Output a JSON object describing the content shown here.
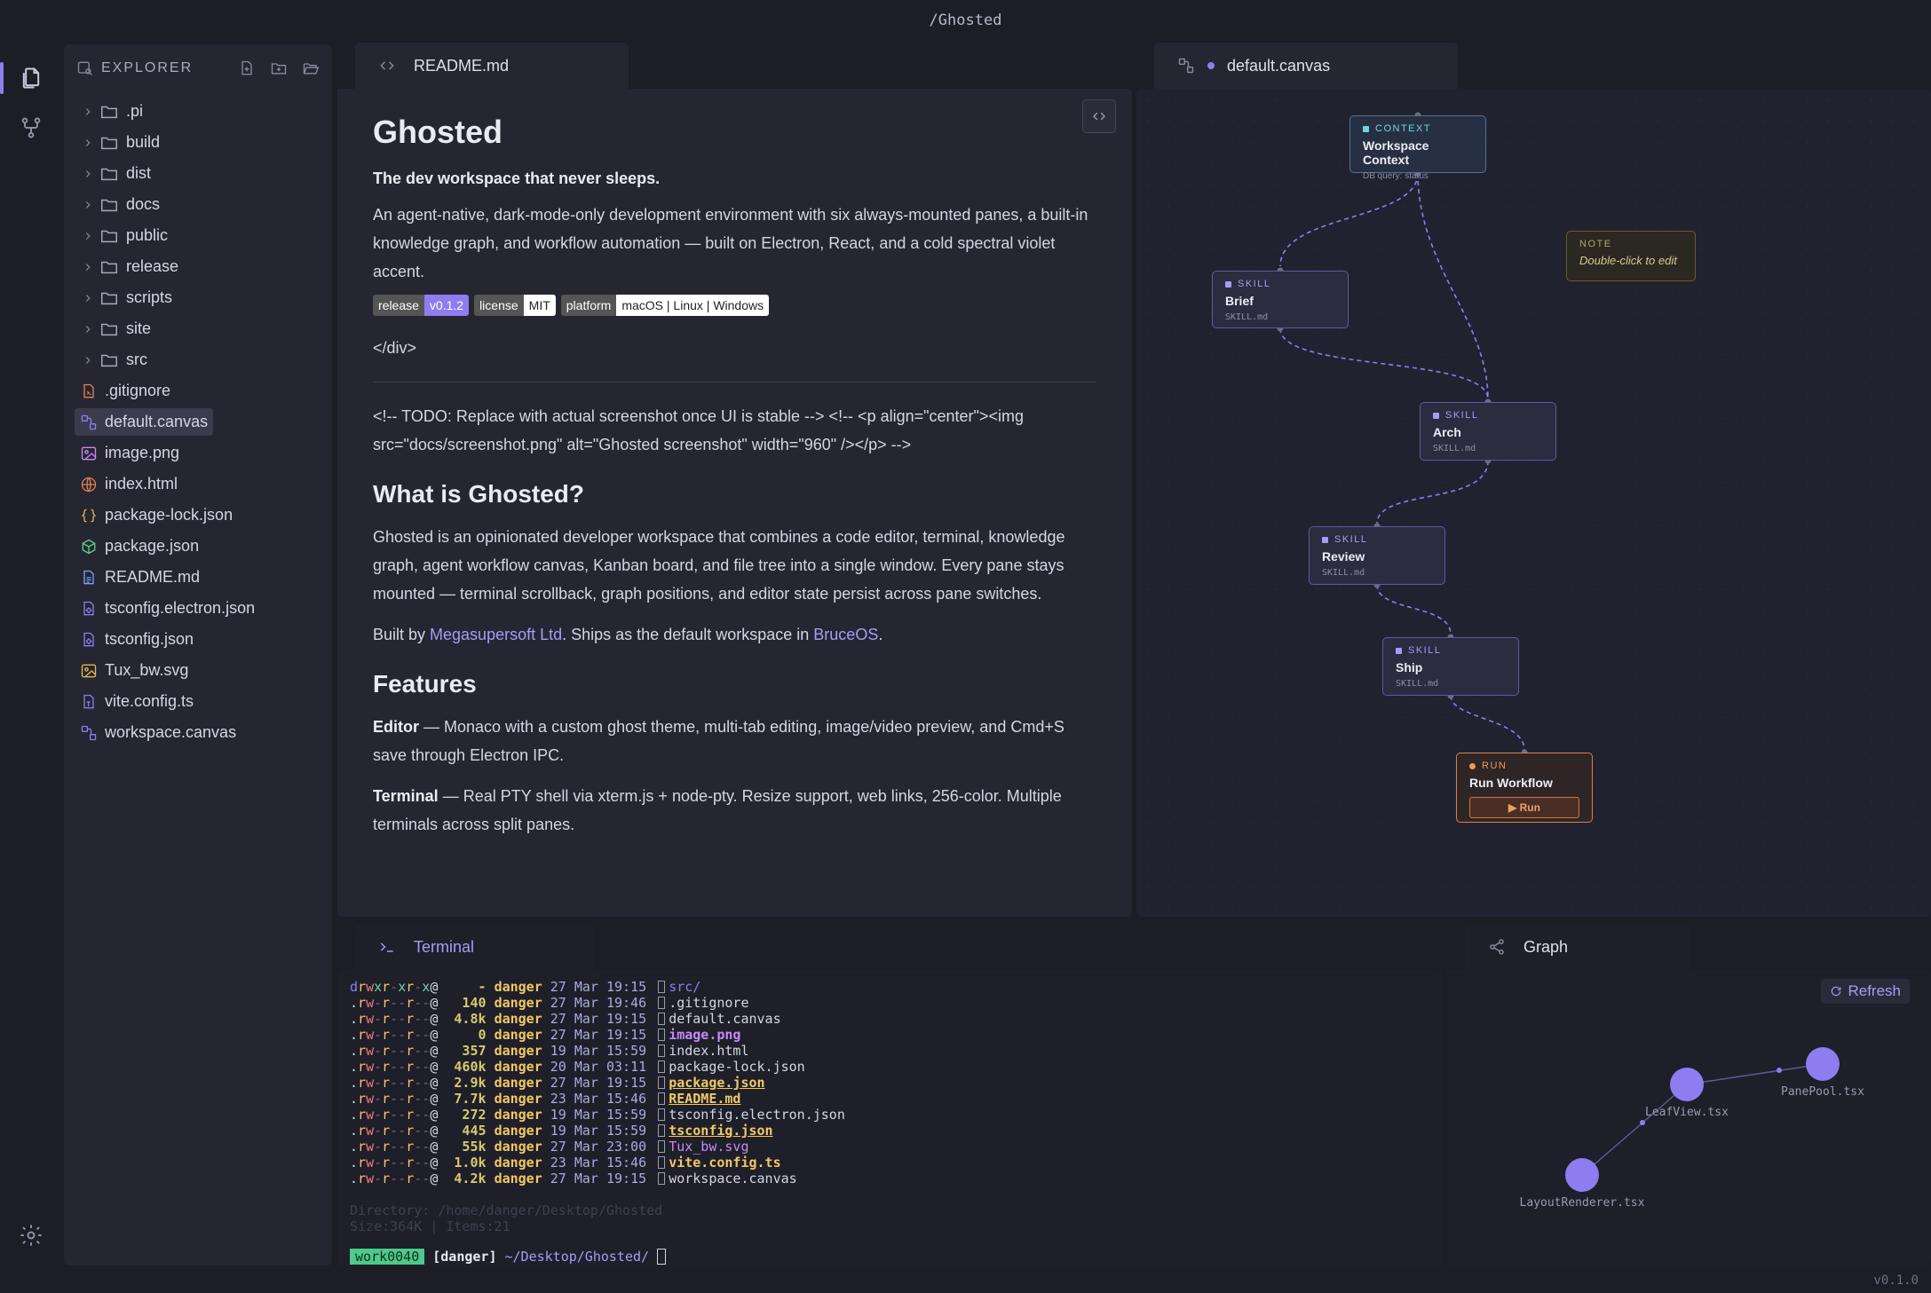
{
  "window": {
    "title": "/Ghosted",
    "version": "v0.1.0"
  },
  "sidebar": {
    "title": "EXPLORER",
    "folders": [
      ".pi",
      "build",
      "dist",
      "docs",
      "public",
      "release",
      "scripts",
      "site",
      "src"
    ],
    "files": [
      {
        "name": ".gitignore",
        "icon": "git-icon",
        "color": "#e0834a"
      },
      {
        "name": "default.canvas",
        "icon": "canvas-icon",
        "color": "#8f7cf0",
        "selected": true
      },
      {
        "name": "image.png",
        "icon": "image-icon",
        "color": "#c58af5"
      },
      {
        "name": "index.html",
        "icon": "globe-icon",
        "color": "#e0834a"
      },
      {
        "name": "package-lock.json",
        "icon": "braces-icon",
        "color": "#e6b84a"
      },
      {
        "name": "package.json",
        "icon": "package-icon",
        "color": "#5fcf8a"
      },
      {
        "name": "README.md",
        "icon": "doc-icon",
        "color": "#7aa2f7"
      },
      {
        "name": "tsconfig.electron.json",
        "icon": "gear-file-icon",
        "color": "#8f7cf0"
      },
      {
        "name": "tsconfig.json",
        "icon": "gear-file-icon",
        "color": "#8f7cf0"
      },
      {
        "name": "Tux_bw.svg",
        "icon": "image-icon",
        "color": "#e6b84a"
      },
      {
        "name": "vite.config.ts",
        "icon": "ts-icon",
        "color": "#8f7cf0"
      },
      {
        "name": "workspace.canvas",
        "icon": "canvas-icon",
        "color": "#8f7cf0"
      }
    ]
  },
  "tabs": {
    "readme": "README.md",
    "canvas": "default.canvas",
    "terminal": "Terminal",
    "graph": "Graph"
  },
  "readme": {
    "h1": "Ghosted",
    "tagline": "The dev workspace that never sleeps.",
    "intro": "An agent-native, dark-mode-only development environment with six always-mounted panes, a built-in knowledge graph, and workflow automation — built on Electron, React, and a cold spectral violet accent.",
    "badges": [
      {
        "k": "release",
        "v": "v0.1.2",
        "color": "#8f7cf0",
        "text": "#ffffff"
      },
      {
        "k": "license",
        "v": "MIT",
        "color": "#ffffff",
        "text": "#222222"
      },
      {
        "k": "platform",
        "v": "macOS | Linux | Windows",
        "color": "#ffffff",
        "text": "#222222"
      }
    ],
    "closing_div": "</div>",
    "todo": "<!-- TODO: Replace with actual screenshot once UI is stable --> <!-- <p align=\"center\"><img src=\"docs/screenshot.png\" alt=\"Ghosted screenshot\" width=\"960\" /></p> -->",
    "h2_what": "What is Ghosted?",
    "what_p": "Ghosted is an opinionated developer workspace that combines a code editor, terminal, knowledge graph, agent workflow canvas, Kanban board, and file tree into a single window. Every pane stays mounted — terminal scrollback, graph positions, and editor state persist across pane switches.",
    "built_pre": "Built by ",
    "built_link1": "Megasupersoft Ltd",
    "built_mid": ". Ships as the default workspace in ",
    "built_link2": "BruceOS",
    "built_post": ".",
    "h2_features": "Features",
    "feat_editor_k": "Editor",
    "feat_editor_v": " — Monaco with a custom ghost theme, multi-tab editing, image/video preview, and Cmd+S save through Electron IPC.",
    "feat_term_k": "Terminal",
    "feat_term_v": " — Real PTY shell via xterm.js + node-pty. Resize support, web links, 256-color. Multiple terminals across split panes."
  },
  "canvas": {
    "nodes": {
      "context": {
        "kind": "CONTEXT",
        "title": "Workspace Context",
        "sub": "DB query: status"
      },
      "note": {
        "kind": "NOTE",
        "title": "Double-click to edit"
      },
      "brief": {
        "kind": "SKILL",
        "title": "Brief",
        "sub": "SKILL.md"
      },
      "arch": {
        "kind": "SKILL",
        "title": "Arch",
        "sub": "SKILL.md"
      },
      "review": {
        "kind": "SKILL",
        "title": "Review",
        "sub": "SKILL.md"
      },
      "ship": {
        "kind": "SKILL",
        "title": "Ship",
        "sub": "SKILL.md"
      },
      "run": {
        "kind": "RUN",
        "title": "Run Workflow",
        "button": "▶ Run"
      }
    }
  },
  "terminal": {
    "rows": [
      {
        "perm": "drwxr-xr-x@",
        "size": "-",
        "user": "danger",
        "date": "27 Mar 19:15",
        "name": "src/",
        "cls": "f-dir"
      },
      {
        "perm": ".rw-r--r--@",
        "size": "140",
        "user": "danger",
        "date": "27 Mar 19:46",
        "name": ".gitignore",
        "cls": ""
      },
      {
        "perm": ".rw-r--r--@",
        "size": "4.8k",
        "user": "danger",
        "date": "27 Mar 19:15",
        "name": "default.canvas",
        "cls": ""
      },
      {
        "perm": ".rw-r--r--@",
        "size": "0",
        "user": "danger",
        "date": "27 Mar 19:15",
        "name": "image.png",
        "cls": "f-img"
      },
      {
        "perm": ".rw-r--r--@",
        "size": "357",
        "user": "danger",
        "date": "19 Mar 15:59",
        "name": "index.html",
        "cls": ""
      },
      {
        "perm": ".rw-r--r--@",
        "size": "460k",
        "user": "danger",
        "date": "20 Mar 03:11",
        "name": "package-lock.json",
        "cls": ""
      },
      {
        "perm": ".rw-r--r--@",
        "size": "2.9k",
        "user": "danger",
        "date": "27 Mar 19:15",
        "name": "package.json",
        "cls": "f-json"
      },
      {
        "perm": ".rw-r--r--@",
        "size": "7.7k",
        "user": "danger",
        "date": "23 Mar 15:46",
        "name": "README.md",
        "cls": "f-md"
      },
      {
        "perm": ".rw-r--r--@",
        "size": "272",
        "user": "danger",
        "date": "19 Mar 15:59",
        "name": "tsconfig.electron.json",
        "cls": ""
      },
      {
        "perm": ".rw-r--r--@",
        "size": "445",
        "user": "danger",
        "date": "19 Mar 15:59",
        "name": "tsconfig.json",
        "cls": "f-json"
      },
      {
        "perm": ".rw-r--r--@",
        "size": "55k",
        "user": "danger",
        "date": "27 Mar 23:00",
        "name": "Tux_bw.svg",
        "cls": "f-svg"
      },
      {
        "perm": ".rw-r--r--@",
        "size": "1.0k",
        "user": "danger",
        "date": "23 Mar 15:46",
        "name": "vite.config.ts",
        "cls": "f-ts"
      },
      {
        "perm": ".rw-r--r--@",
        "size": "4.2k",
        "user": "danger",
        "date": "27 Mar 19:15",
        "name": "workspace.canvas",
        "cls": ""
      }
    ],
    "footer1": "Directory: /home/danger/Desktop/Ghosted",
    "footer2": "Size:364K | Items:21",
    "prompt_session": "work0040",
    "prompt_user": "[danger]",
    "prompt_path": "~/Desktop/Ghosted/"
  },
  "graph": {
    "refresh": "Refresh",
    "nodes": [
      {
        "id": "leafview",
        "label": "LeafView.tsx"
      },
      {
        "id": "panepool",
        "label": "PanePool.tsx"
      },
      {
        "id": "layoutrenderer",
        "label": "LayoutRenderer.tsx"
      }
    ]
  }
}
